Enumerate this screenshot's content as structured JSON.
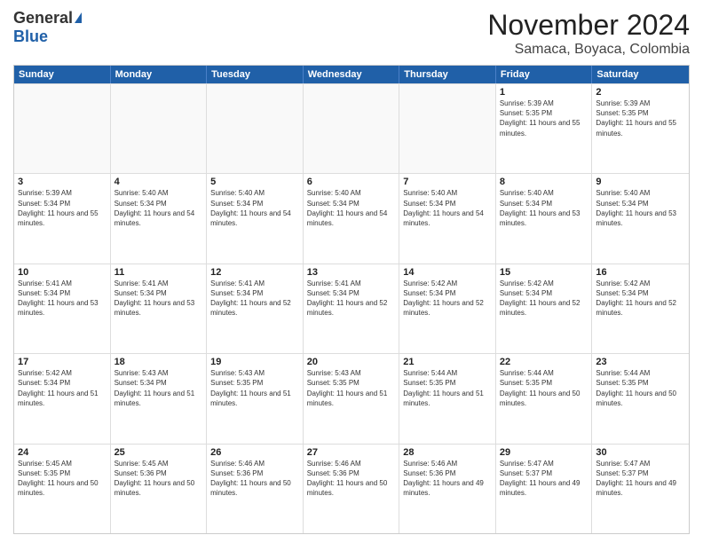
{
  "logo": {
    "general": "General",
    "blue": "Blue"
  },
  "header": {
    "month": "November 2024",
    "location": "Samaca, Boyaca, Colombia"
  },
  "weekdays": [
    "Sunday",
    "Monday",
    "Tuesday",
    "Wednesday",
    "Thursday",
    "Friday",
    "Saturday"
  ],
  "rows": [
    [
      {
        "day": "",
        "sunrise": "",
        "sunset": "",
        "daylight": "",
        "empty": true
      },
      {
        "day": "",
        "sunrise": "",
        "sunset": "",
        "daylight": "",
        "empty": true
      },
      {
        "day": "",
        "sunrise": "",
        "sunset": "",
        "daylight": "",
        "empty": true
      },
      {
        "day": "",
        "sunrise": "",
        "sunset": "",
        "daylight": "",
        "empty": true
      },
      {
        "day": "",
        "sunrise": "",
        "sunset": "",
        "daylight": "",
        "empty": true
      },
      {
        "day": "1",
        "sunrise": "Sunrise: 5:39 AM",
        "sunset": "Sunset: 5:35 PM",
        "daylight": "Daylight: 11 hours and 55 minutes.",
        "empty": false
      },
      {
        "day": "2",
        "sunrise": "Sunrise: 5:39 AM",
        "sunset": "Sunset: 5:35 PM",
        "daylight": "Daylight: 11 hours and 55 minutes.",
        "empty": false
      }
    ],
    [
      {
        "day": "3",
        "sunrise": "Sunrise: 5:39 AM",
        "sunset": "Sunset: 5:34 PM",
        "daylight": "Daylight: 11 hours and 55 minutes.",
        "empty": false
      },
      {
        "day": "4",
        "sunrise": "Sunrise: 5:40 AM",
        "sunset": "Sunset: 5:34 PM",
        "daylight": "Daylight: 11 hours and 54 minutes.",
        "empty": false
      },
      {
        "day": "5",
        "sunrise": "Sunrise: 5:40 AM",
        "sunset": "Sunset: 5:34 PM",
        "daylight": "Daylight: 11 hours and 54 minutes.",
        "empty": false
      },
      {
        "day": "6",
        "sunrise": "Sunrise: 5:40 AM",
        "sunset": "Sunset: 5:34 PM",
        "daylight": "Daylight: 11 hours and 54 minutes.",
        "empty": false
      },
      {
        "day": "7",
        "sunrise": "Sunrise: 5:40 AM",
        "sunset": "Sunset: 5:34 PM",
        "daylight": "Daylight: 11 hours and 54 minutes.",
        "empty": false
      },
      {
        "day": "8",
        "sunrise": "Sunrise: 5:40 AM",
        "sunset": "Sunset: 5:34 PM",
        "daylight": "Daylight: 11 hours and 53 minutes.",
        "empty": false
      },
      {
        "day": "9",
        "sunrise": "Sunrise: 5:40 AM",
        "sunset": "Sunset: 5:34 PM",
        "daylight": "Daylight: 11 hours and 53 minutes.",
        "empty": false
      }
    ],
    [
      {
        "day": "10",
        "sunrise": "Sunrise: 5:41 AM",
        "sunset": "Sunset: 5:34 PM",
        "daylight": "Daylight: 11 hours and 53 minutes.",
        "empty": false
      },
      {
        "day": "11",
        "sunrise": "Sunrise: 5:41 AM",
        "sunset": "Sunset: 5:34 PM",
        "daylight": "Daylight: 11 hours and 53 minutes.",
        "empty": false
      },
      {
        "day": "12",
        "sunrise": "Sunrise: 5:41 AM",
        "sunset": "Sunset: 5:34 PM",
        "daylight": "Daylight: 11 hours and 52 minutes.",
        "empty": false
      },
      {
        "day": "13",
        "sunrise": "Sunrise: 5:41 AM",
        "sunset": "Sunset: 5:34 PM",
        "daylight": "Daylight: 11 hours and 52 minutes.",
        "empty": false
      },
      {
        "day": "14",
        "sunrise": "Sunrise: 5:42 AM",
        "sunset": "Sunset: 5:34 PM",
        "daylight": "Daylight: 11 hours and 52 minutes.",
        "empty": false
      },
      {
        "day": "15",
        "sunrise": "Sunrise: 5:42 AM",
        "sunset": "Sunset: 5:34 PM",
        "daylight": "Daylight: 11 hours and 52 minutes.",
        "empty": false
      },
      {
        "day": "16",
        "sunrise": "Sunrise: 5:42 AM",
        "sunset": "Sunset: 5:34 PM",
        "daylight": "Daylight: 11 hours and 52 minutes.",
        "empty": false
      }
    ],
    [
      {
        "day": "17",
        "sunrise": "Sunrise: 5:42 AM",
        "sunset": "Sunset: 5:34 PM",
        "daylight": "Daylight: 11 hours and 51 minutes.",
        "empty": false
      },
      {
        "day": "18",
        "sunrise": "Sunrise: 5:43 AM",
        "sunset": "Sunset: 5:34 PM",
        "daylight": "Daylight: 11 hours and 51 minutes.",
        "empty": false
      },
      {
        "day": "19",
        "sunrise": "Sunrise: 5:43 AM",
        "sunset": "Sunset: 5:35 PM",
        "daylight": "Daylight: 11 hours and 51 minutes.",
        "empty": false
      },
      {
        "day": "20",
        "sunrise": "Sunrise: 5:43 AM",
        "sunset": "Sunset: 5:35 PM",
        "daylight": "Daylight: 11 hours and 51 minutes.",
        "empty": false
      },
      {
        "day": "21",
        "sunrise": "Sunrise: 5:44 AM",
        "sunset": "Sunset: 5:35 PM",
        "daylight": "Daylight: 11 hours and 51 minutes.",
        "empty": false
      },
      {
        "day": "22",
        "sunrise": "Sunrise: 5:44 AM",
        "sunset": "Sunset: 5:35 PM",
        "daylight": "Daylight: 11 hours and 50 minutes.",
        "empty": false
      },
      {
        "day": "23",
        "sunrise": "Sunrise: 5:44 AM",
        "sunset": "Sunset: 5:35 PM",
        "daylight": "Daylight: 11 hours and 50 minutes.",
        "empty": false
      }
    ],
    [
      {
        "day": "24",
        "sunrise": "Sunrise: 5:45 AM",
        "sunset": "Sunset: 5:35 PM",
        "daylight": "Daylight: 11 hours and 50 minutes.",
        "empty": false
      },
      {
        "day": "25",
        "sunrise": "Sunrise: 5:45 AM",
        "sunset": "Sunset: 5:36 PM",
        "daylight": "Daylight: 11 hours and 50 minutes.",
        "empty": false
      },
      {
        "day": "26",
        "sunrise": "Sunrise: 5:46 AM",
        "sunset": "Sunset: 5:36 PM",
        "daylight": "Daylight: 11 hours and 50 minutes.",
        "empty": false
      },
      {
        "day": "27",
        "sunrise": "Sunrise: 5:46 AM",
        "sunset": "Sunset: 5:36 PM",
        "daylight": "Daylight: 11 hours and 50 minutes.",
        "empty": false
      },
      {
        "day": "28",
        "sunrise": "Sunrise: 5:46 AM",
        "sunset": "Sunset: 5:36 PM",
        "daylight": "Daylight: 11 hours and 49 minutes.",
        "empty": false
      },
      {
        "day": "29",
        "sunrise": "Sunrise: 5:47 AM",
        "sunset": "Sunset: 5:37 PM",
        "daylight": "Daylight: 11 hours and 49 minutes.",
        "empty": false
      },
      {
        "day": "30",
        "sunrise": "Sunrise: 5:47 AM",
        "sunset": "Sunset: 5:37 PM",
        "daylight": "Daylight: 11 hours and 49 minutes.",
        "empty": false
      }
    ]
  ]
}
